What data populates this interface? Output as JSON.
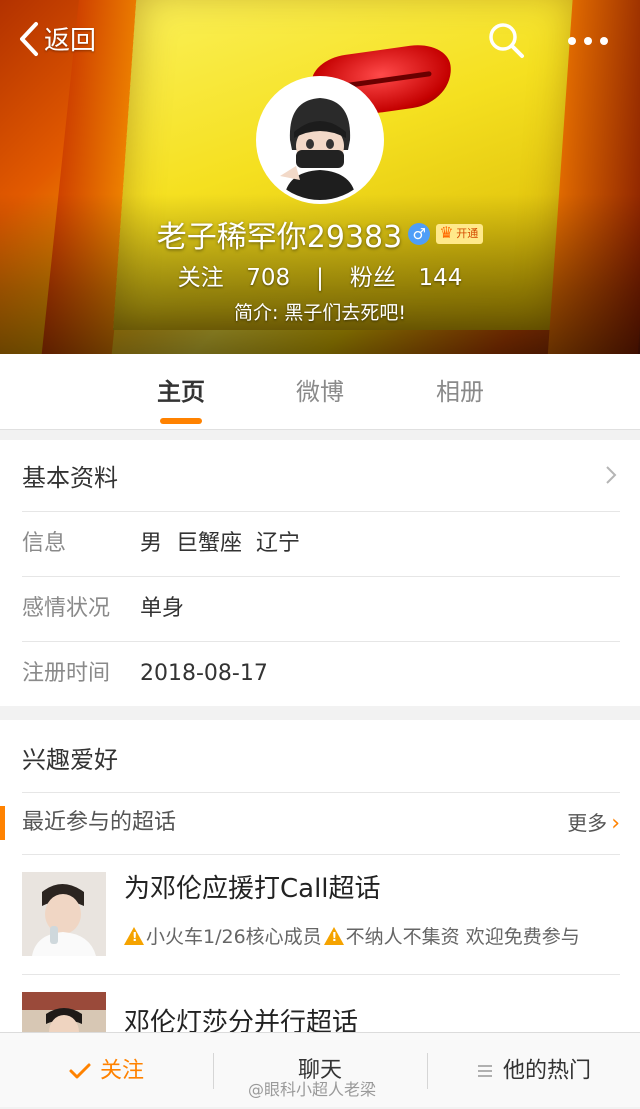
{
  "nav": {
    "back_label": "返回"
  },
  "profile": {
    "nickname": "老子稀罕你29383",
    "gender_symbol": "♂",
    "vip_label": "开通",
    "following_label": "关注",
    "following_count": "708",
    "fans_label": "粉丝",
    "fans_count": "144",
    "stats_separator": "|",
    "bio": "简介: 黑子们去死吧!"
  },
  "tabs": [
    {
      "label": "主页",
      "active": true
    },
    {
      "label": "微博",
      "active": false
    },
    {
      "label": "相册",
      "active": false
    }
  ],
  "basic_info": {
    "title": "基本资料",
    "rows": [
      {
        "label": "信息",
        "value": "男  巨蟹座  辽宁"
      },
      {
        "label": "感情状况",
        "value": "单身"
      },
      {
        "label": "注册时间",
        "value": "2018-08-17"
      }
    ]
  },
  "interests": {
    "title": "兴趣爱好",
    "recent_topics_label": "最近参与的超话",
    "more_label": "更多",
    "topics": [
      {
        "name": "为邓伦应援打Call超话",
        "meta_1": "小火车1/26核心成员",
        "meta_2": "不纳人不集资 欢迎免费参与"
      },
      {
        "name": "邓伦灯莎分并行超话"
      }
    ]
  },
  "bottom_bar": {
    "follow_label": "关注",
    "chat_label": "聊天",
    "hot_label": "他的热门"
  },
  "watermark": "@眼科小超人老梁",
  "colors": {
    "accent": "#ff8200",
    "gender": "#4f9ef8",
    "warning": "#f5a300"
  }
}
